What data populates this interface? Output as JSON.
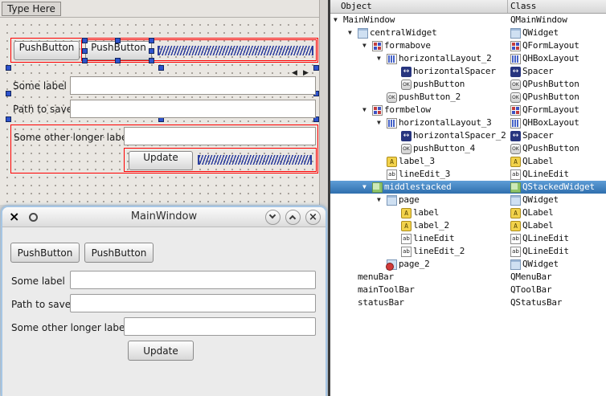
{
  "designer": {
    "menu_placeholder": "Type Here",
    "push_button_1": "PushButton",
    "push_button_2": "PushButton",
    "some_label": "Some label",
    "path_label": "Path to save",
    "longer_label": "Some other longer label",
    "update_button": "Update",
    "stacked_nav_prev": "◀",
    "stacked_nav_next": "▶"
  },
  "preview": {
    "title": "MainWindow",
    "push_button_1": "PushButton",
    "push_button_2": "PushButton",
    "some_label": "Some label",
    "path_label": "Path to save",
    "longer_label": "Some other longer label",
    "update_button": "Update",
    "menu_glyph": "×",
    "close_glyph": "×"
  },
  "inspector": {
    "columns": [
      "Object",
      "Class"
    ],
    "rows": [
      {
        "name": "MainWindow",
        "cls": "QMainWindow",
        "level": 0,
        "arrow": true,
        "obj_icon": null,
        "cls_icon": null,
        "selected": false
      },
      {
        "name": "centralWidget",
        "cls": "QWidget",
        "level": 1,
        "arrow": true,
        "obj_icon": "widget",
        "cls_icon": "widget",
        "selected": false
      },
      {
        "name": "formabove",
        "cls": "QFormLayout",
        "level": 2,
        "arrow": true,
        "obj_icon": "form",
        "cls_icon": "form",
        "selected": false
      },
      {
        "name": "horizontalLayout_2",
        "cls": "QHBoxLayout",
        "level": 3,
        "arrow": true,
        "obj_icon": "hbox",
        "cls_icon": "hbox",
        "selected": false
      },
      {
        "name": "horizontalSpacer",
        "cls": "Spacer",
        "level": 4,
        "arrow": false,
        "obj_icon": "spacer",
        "cls_icon": "spacer",
        "selected": false
      },
      {
        "name": "pushButton",
        "cls": "QPushButton",
        "level": 4,
        "arrow": false,
        "obj_icon": "button",
        "cls_icon": "button",
        "selected": false
      },
      {
        "name": "pushButton_2",
        "cls": "QPushButton",
        "level": 3,
        "arrow": false,
        "obj_icon": "button",
        "cls_icon": "button",
        "selected": false
      },
      {
        "name": "formbelow",
        "cls": "QFormLayout",
        "level": 2,
        "arrow": true,
        "obj_icon": "form",
        "cls_icon": "form",
        "selected": false
      },
      {
        "name": "horizontalLayout_3",
        "cls": "QHBoxLayout",
        "level": 3,
        "arrow": true,
        "obj_icon": "hbox",
        "cls_icon": "hbox",
        "selected": false
      },
      {
        "name": "horizontalSpacer_2",
        "cls": "Spacer",
        "level": 4,
        "arrow": false,
        "obj_icon": "spacer",
        "cls_icon": "spacer",
        "selected": false
      },
      {
        "name": "pushButton_4",
        "cls": "QPushButton",
        "level": 4,
        "arrow": false,
        "obj_icon": "button",
        "cls_icon": "button",
        "selected": false
      },
      {
        "name": "label_3",
        "cls": "QLabel",
        "level": 3,
        "arrow": false,
        "obj_icon": "label",
        "cls_icon": "label",
        "selected": false
      },
      {
        "name": "lineEdit_3",
        "cls": "QLineEdit",
        "level": 3,
        "arrow": false,
        "obj_icon": "lineedit",
        "cls_icon": "lineedit",
        "selected": false
      },
      {
        "name": "middlestacked",
        "cls": "QStackedWidget",
        "level": 2,
        "arrow": true,
        "obj_icon": "stacked",
        "cls_icon": "stacked",
        "selected": true
      },
      {
        "name": "page",
        "cls": "QWidget",
        "level": 3,
        "arrow": true,
        "obj_icon": "widget",
        "cls_icon": "widget",
        "selected": false
      },
      {
        "name": "label",
        "cls": "QLabel",
        "level": 4,
        "arrow": false,
        "obj_icon": "label",
        "cls_icon": "label",
        "selected": false
      },
      {
        "name": "label_2",
        "cls": "QLabel",
        "level": 4,
        "arrow": false,
        "obj_icon": "label",
        "cls_icon": "label",
        "selected": false
      },
      {
        "name": "lineEdit",
        "cls": "QLineEdit",
        "level": 4,
        "arrow": false,
        "obj_icon": "lineedit",
        "cls_icon": "lineedit",
        "selected": false
      },
      {
        "name": "lineEdit_2",
        "cls": "QLineEdit",
        "level": 4,
        "arrow": false,
        "obj_icon": "lineedit",
        "cls_icon": "lineedit",
        "selected": false
      },
      {
        "name": "page_2",
        "cls": "QWidget",
        "level": 3,
        "arrow": false,
        "obj_icon": "page2",
        "cls_icon": "widget",
        "selected": false
      },
      {
        "name": "menuBar",
        "cls": "QMenuBar",
        "level": 1,
        "arrow": false,
        "obj_icon": null,
        "cls_icon": null,
        "selected": false
      },
      {
        "name": "mainToolBar",
        "cls": "QToolBar",
        "level": 1,
        "arrow": false,
        "obj_icon": null,
        "cls_icon": null,
        "selected": false
      },
      {
        "name": "statusBar",
        "cls": "QStatusBar",
        "level": 1,
        "arrow": false,
        "obj_icon": null,
        "cls_icon": null,
        "selected": false
      }
    ]
  },
  "colors": {
    "selection_blue": "#3d84c8",
    "layout_outline_red": "#ff0000",
    "handle_blue": "#2d52cc",
    "spacer_blue": "#2c3e9e"
  }
}
